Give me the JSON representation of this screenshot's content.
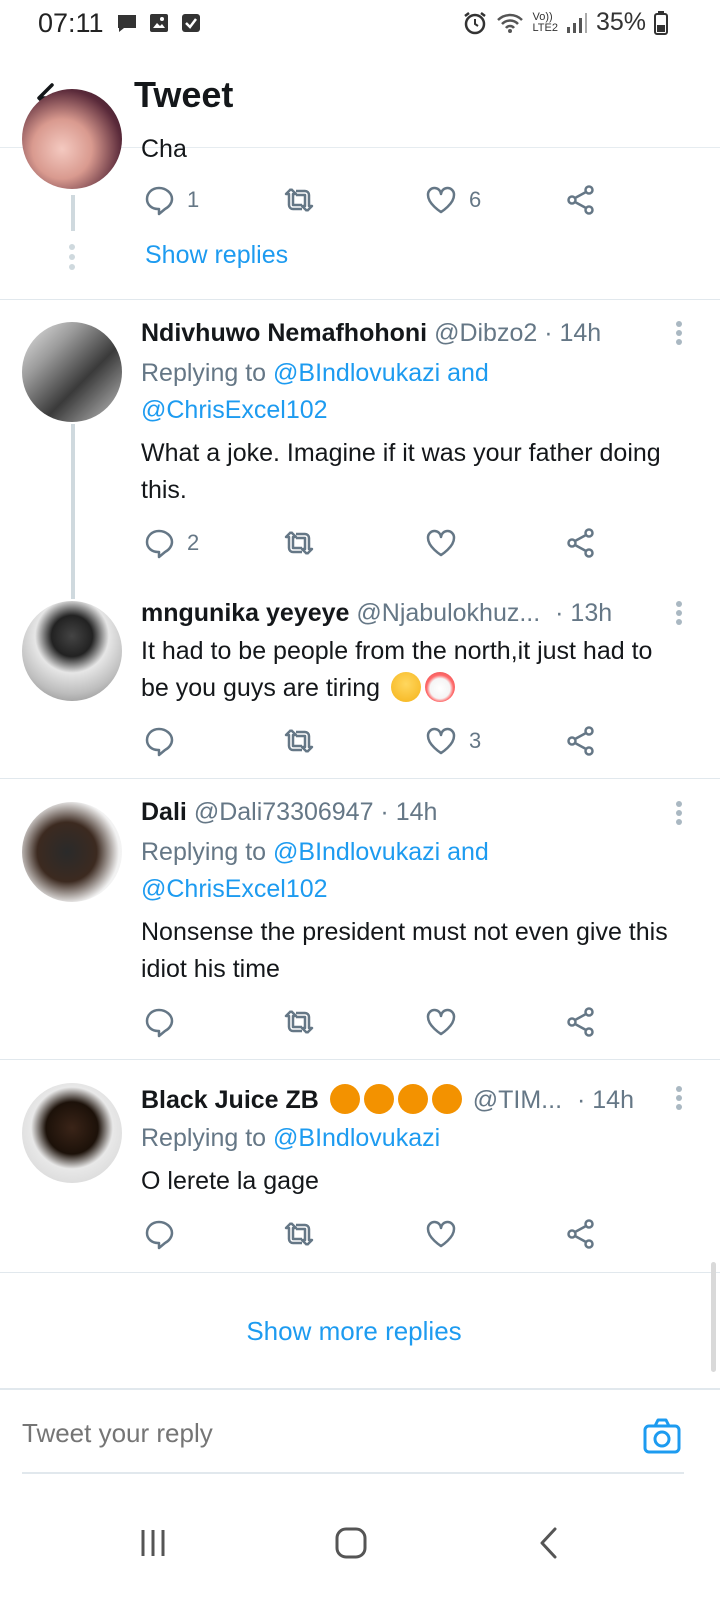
{
  "status_bar": {
    "time": "07:11",
    "battery": "35%",
    "network_top": "Vo))",
    "network_bottom": "LTE2"
  },
  "header": {
    "title": "Tweet"
  },
  "top_tweet": {
    "partial_text": "Cha",
    "reply_count": "1",
    "like_count": "6",
    "show_replies": "Show replies"
  },
  "tweets": [
    {
      "name": "Ndivhuwo Nemafhohoni",
      "handle": "@Dibzo2 · 14h",
      "replying_prefix": "Replying to ",
      "replying_mention_1": "@BIndlovukazi and",
      "replying_mention_2": "@ChrisExcel102",
      "text": "What a joke. Imagine if it was your father doing this.",
      "reply_count": "2",
      "like_count": ""
    },
    {
      "name": "mngunika yeyeye",
      "handle": "@Njabulokhuz...",
      "time": "· 13h",
      "text": "It had to be people from the north,it just had to be you guys are tiring",
      "reply_count": "",
      "like_count": "3"
    },
    {
      "name": "Dali",
      "handle": "@Dali73306947 · 14h",
      "replying_prefix": "Replying to ",
      "replying_mention_1": "@BIndlovukazi and",
      "replying_mention_2": "@ChrisExcel102",
      "text": "Nonsense the president must not even give this idiot his time",
      "reply_count": "",
      "like_count": ""
    },
    {
      "name": "Black Juice ZB",
      "handle": "@TIM...",
      "time": "· 14h",
      "replying_prefix": "Replying to ",
      "replying_mention_1": "@BIndlovukazi",
      "text": "O lerete la gage",
      "reply_count": "",
      "like_count": ""
    }
  ],
  "show_more_replies": "Show more replies",
  "reply_box": {
    "placeholder": "Tweet your reply"
  },
  "colors": {
    "accent": "#1d9bf0",
    "muted": "#657786",
    "text": "#14171a"
  }
}
